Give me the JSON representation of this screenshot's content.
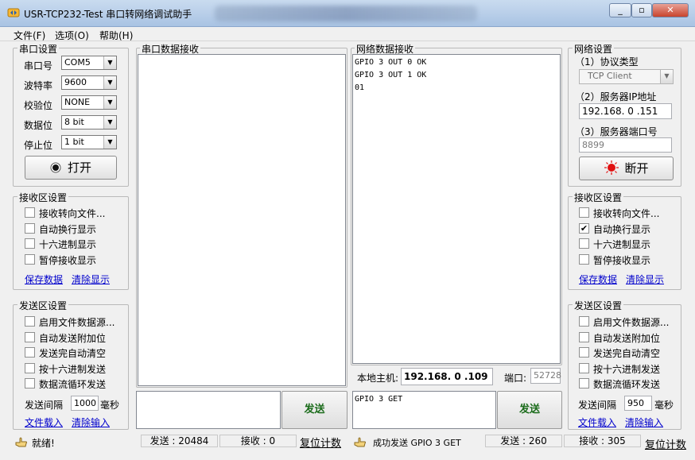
{
  "window": {
    "title": "USR-TCP232-Test 串口转网络调试助手",
    "min": "_",
    "max": "▫",
    "close": "✕"
  },
  "menu": [
    "文件(F)",
    "选项(O)",
    "帮助(H)"
  ],
  "serial_settings": {
    "title": "串口设置",
    "port_label": "串口号",
    "port_value": "COM5",
    "baud_label": "波特率",
    "baud_value": "9600",
    "parity_label": "校验位",
    "parity_value": "NONE",
    "databits_label": "数据位",
    "databits_value": "8 bit",
    "stopbits_label": "停止位",
    "stopbits_value": "1 bit",
    "open_button": "打开"
  },
  "left_recv": {
    "title": "接收区设置",
    "options": [
      {
        "label": "接收转向文件...",
        "checked": false
      },
      {
        "label": "自动换行显示",
        "checked": false
      },
      {
        "label": "十六进制显示",
        "checked": false
      },
      {
        "label": "暂停接收显示",
        "checked": false
      }
    ],
    "save_link": "保存数据",
    "clear_link": "清除显示"
  },
  "left_send": {
    "title": "发送区设置",
    "options": [
      {
        "label": "启用文件数据源...",
        "checked": false
      },
      {
        "label": "自动发送附加位",
        "checked": false
      },
      {
        "label": "发送完自动清空",
        "checked": false
      },
      {
        "label": "按十六进制发送",
        "checked": false
      },
      {
        "label": "数据流循环发送",
        "checked": false
      }
    ],
    "interval_label": "发送间隔",
    "interval_value": "1000",
    "interval_unit": "毫秒",
    "load_link": "文件载入",
    "clear_link": "清除输入"
  },
  "serial_recv": {
    "title": "串口数据接收",
    "content": ""
  },
  "net_recv": {
    "title": "网络数据接收",
    "content": "GPIO 3 OUT 0 OK\nGPIO 3 OUT 1 OK\n01"
  },
  "local_host": {
    "label": "本地主机:",
    "value": "192.168. 0 .109",
    "port_label": "端口:",
    "port_value": "52728"
  },
  "serial_send": {
    "input": "",
    "button": "发送"
  },
  "net_send": {
    "input": "GPIO 3 GET",
    "button": "发送"
  },
  "net_settings": {
    "title": "网络设置",
    "protocol_label": "（1）协议类型",
    "protocol_value": "TCP Client",
    "ip_label": "（2）服务器IP地址",
    "ip_value": "192.168. 0 .151",
    "port_label": "（3）服务器端口号",
    "port_value": "8899",
    "disconnect_button": "断开"
  },
  "right_recv": {
    "title": "接收区设置",
    "options": [
      {
        "label": "接收转向文件...",
        "checked": false
      },
      {
        "label": "自动换行显示",
        "checked": true
      },
      {
        "label": "十六进制显示",
        "checked": false
      },
      {
        "label": "暂停接收显示",
        "checked": false
      }
    ],
    "save_link": "保存数据",
    "clear_link": "清除显示"
  },
  "right_send": {
    "title": "发送区设置",
    "options": [
      {
        "label": "启用文件数据源...",
        "checked": false
      },
      {
        "label": "自动发送附加位",
        "checked": false
      },
      {
        "label": "发送完自动清空",
        "checked": false
      },
      {
        "label": "按十六进制发送",
        "checked": false
      },
      {
        "label": "数据流循环发送",
        "checked": false
      }
    ],
    "interval_label": "发送间隔",
    "interval_value": "950",
    "interval_unit": "毫秒",
    "load_link": "文件载入",
    "clear_link": "清除输入"
  },
  "status": {
    "left_msg": "就绪!",
    "left_sent": "发送 : 20484",
    "left_recv": "接收 : 0",
    "left_reset": "复位计数",
    "right_msg": "成功发送 GPIO 3 GET",
    "right_sent": "发送 : 260",
    "right_recv": "接收 : 305",
    "right_reset": "复位计数"
  },
  "colors": {
    "link": "#0000cc",
    "send_text": "#1a6b1a",
    "record_red": "#e01010"
  }
}
